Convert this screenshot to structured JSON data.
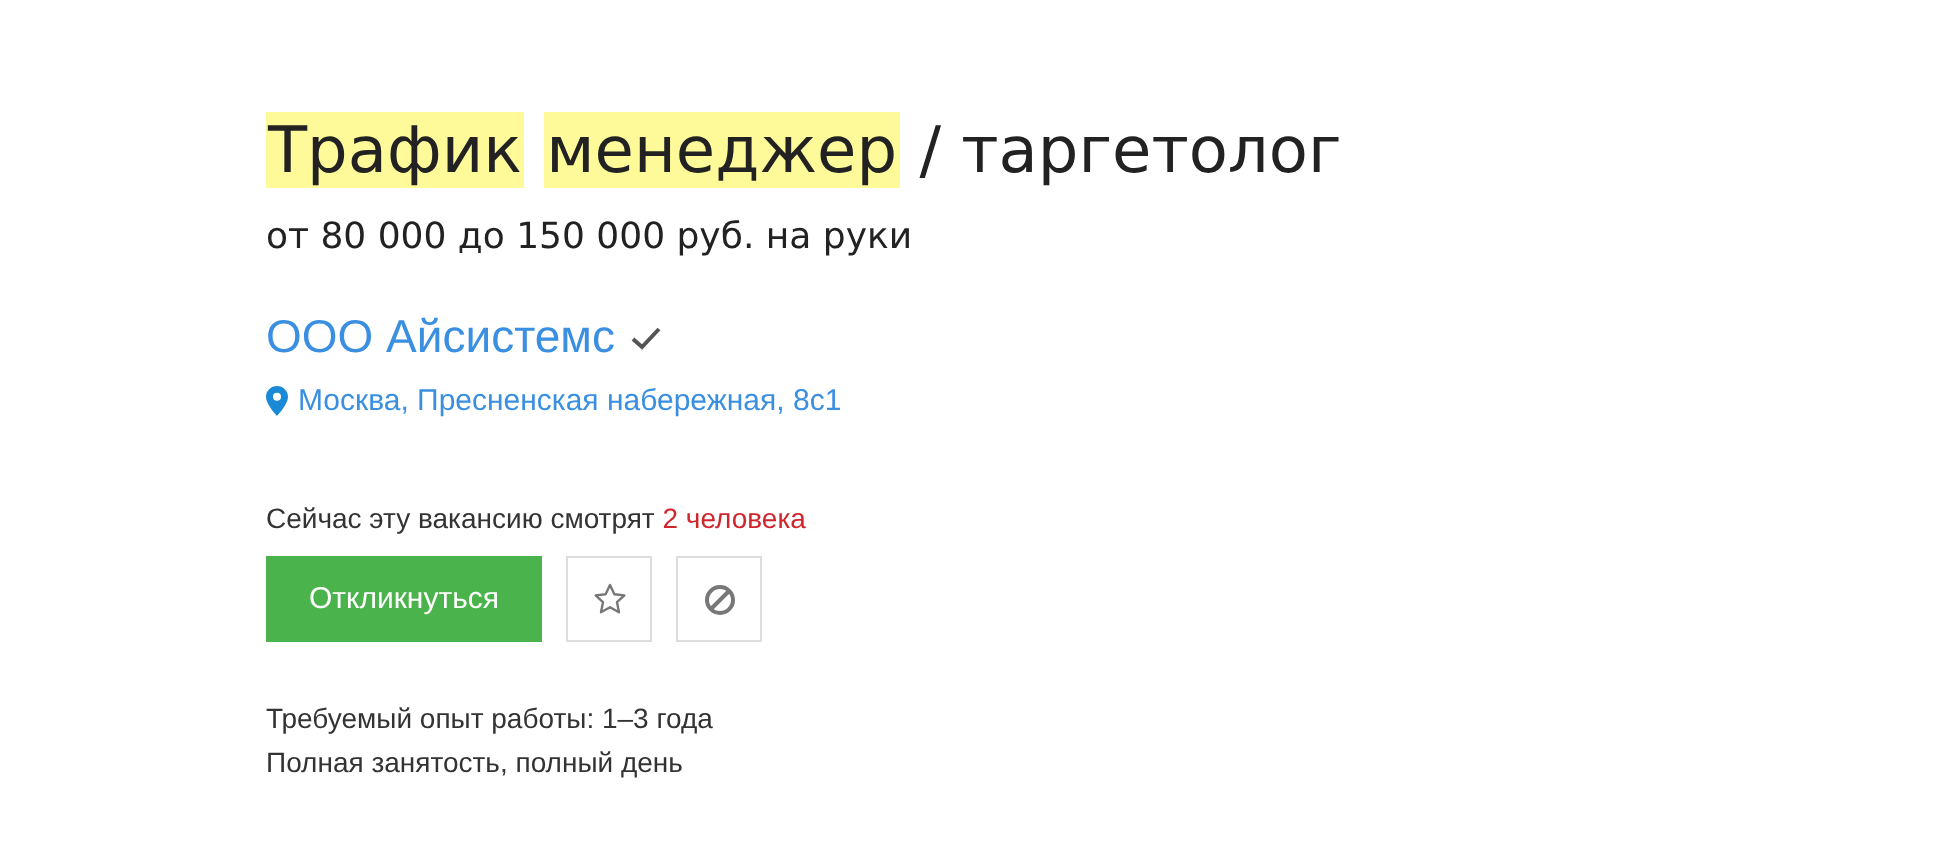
{
  "title": [
    {
      "text": "Трафик",
      "highlighted": true
    },
    {
      "text": "менеджер",
      "highlighted": true
    },
    {
      "text": "/ таргетолог",
      "highlighted": false
    }
  ],
  "salary": "от 80 000 до 150 000 руб. на руки",
  "company": {
    "name": "ООО Айсистемс",
    "verified": true
  },
  "address": "Москва, Пресненская набережная, 8с1",
  "viewers": {
    "text": "Сейчас эту вакансию смотрят",
    "count": "2 человека"
  },
  "apply_button": "Откликнуться",
  "details": [
    "Требуемый опыт работы: 1–3 года",
    "Полная занятость, полный день"
  ]
}
